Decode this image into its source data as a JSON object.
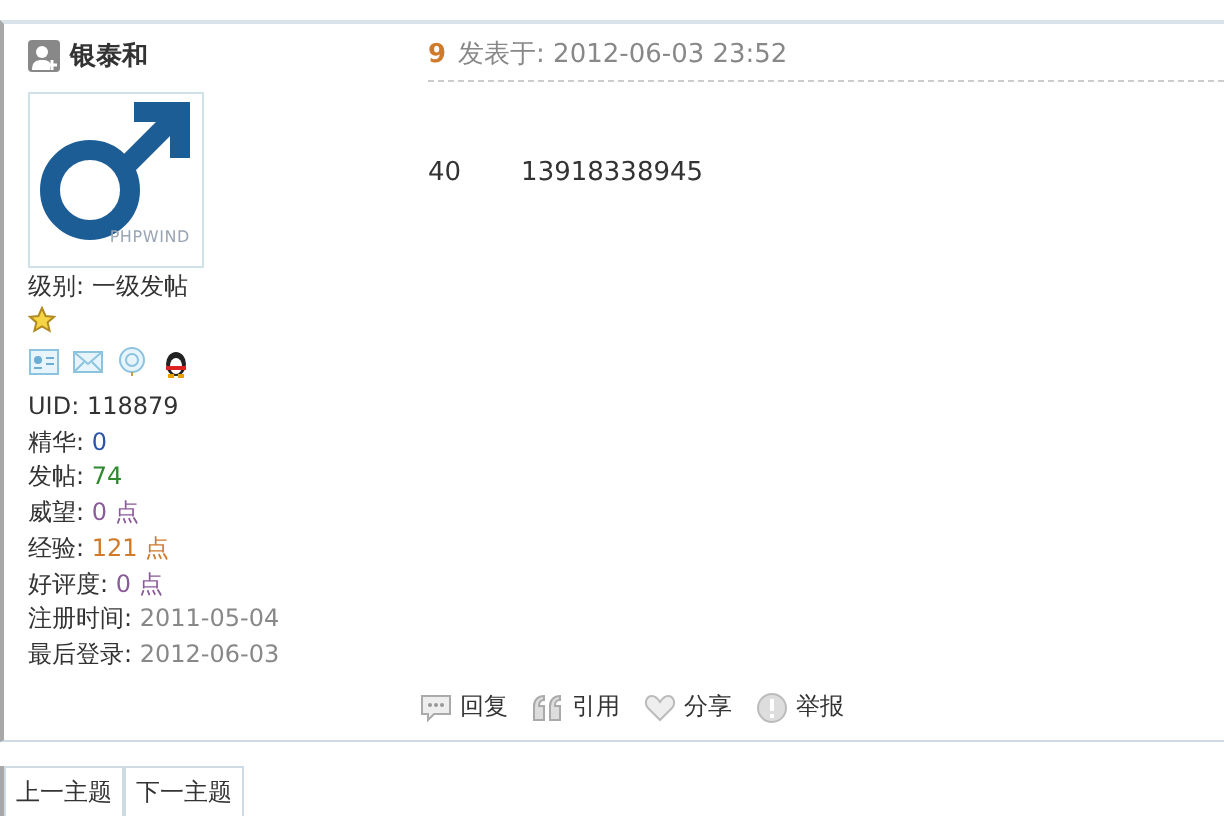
{
  "author": {
    "name": "银泰和",
    "level": "级别: 一级发帖",
    "avatar_text": "PHPWIND"
  },
  "stats": [
    {
      "label": "UID:",
      "value": "118879",
      "color": "#333333"
    },
    {
      "label": "精华:",
      "value": "0",
      "color": "#2a55a8"
    },
    {
      "label": "发帖:",
      "value": "74",
      "color": "#2f8a2f"
    },
    {
      "label": "威望:",
      "value": "0 点",
      "color": "#8a5a9a"
    },
    {
      "label": "经验:",
      "value": "121 点",
      "color": "#d07a2a"
    },
    {
      "label": "好评度:",
      "value": "0 点",
      "color": "#8a5a9a"
    },
    {
      "label": "注册时间:",
      "value": "2011-05-04",
      "color": "#888888"
    },
    {
      "label": "最后登录:",
      "value": "2012-06-03",
      "color": "#888888"
    }
  ],
  "post": {
    "floor": "9",
    "posted": "发表于: 2012-06-03 23:52",
    "content": [
      "40",
      "13918338945"
    ]
  },
  "actions": [
    {
      "kind": "reply",
      "label": "回复"
    },
    {
      "kind": "quote",
      "label": "引用"
    },
    {
      "kind": "share",
      "label": "分享"
    },
    {
      "kind": "report",
      "label": "举报"
    }
  ],
  "nav": [
    "上一主题",
    "下一主题"
  ]
}
